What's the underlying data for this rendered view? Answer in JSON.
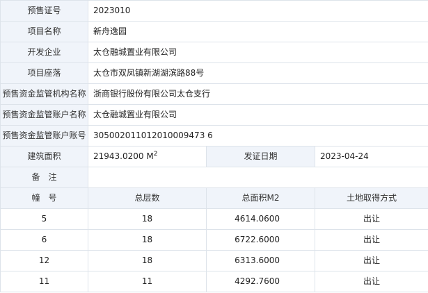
{
  "info_rows": [
    {
      "label": "预售证号",
      "value": "2023010"
    },
    {
      "label": "项目名称",
      "value": "新舟逸园"
    },
    {
      "label": "开发企业",
      "value": "太仓融城置业有限公司"
    },
    {
      "label": "项目座落",
      "value": "太仓市双凤镇新湖湖滨路88号"
    },
    {
      "label": "预售资金监管机构名称",
      "value": "浙商银行股份有限公司太仓支行"
    },
    {
      "label": "预售资金监管账户名称",
      "value": "太仓融城置业有限公司"
    },
    {
      "label": "预售资金监管账户账号",
      "value": "305002011012010009473 6"
    }
  ],
  "area_row": {
    "area_label": "建筑面积",
    "area_value": "21943.0200 M",
    "area_unit_sup": "2",
    "date_label": "发证日期",
    "date_value": "2023-04-24"
  },
  "remark": {
    "label": "备　注",
    "value": ""
  },
  "building_table": {
    "headers": [
      "幢　号",
      "总层数",
      "总面积M2",
      "土地取得方式"
    ],
    "rows": [
      [
        "5",
        "18",
        "4614.0600",
        "出让"
      ],
      [
        "6",
        "18",
        "6722.6000",
        "出让"
      ],
      [
        "12",
        "18",
        "6313.6000",
        "出让"
      ],
      [
        "11",
        "11",
        "4292.7600",
        "出让"
      ]
    ]
  }
}
